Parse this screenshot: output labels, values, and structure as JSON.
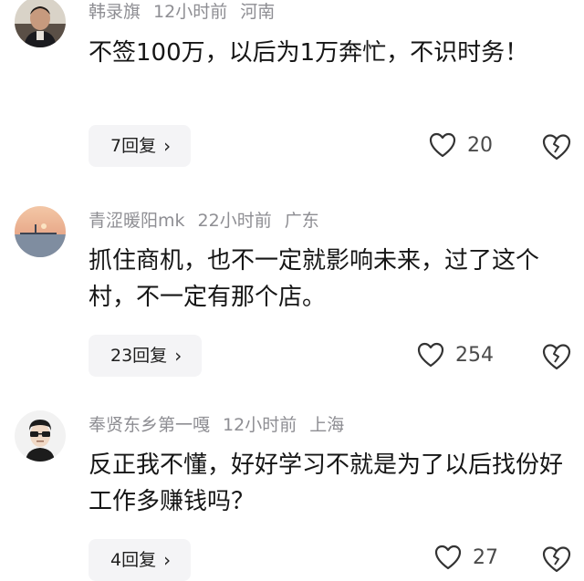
{
  "comments": [
    {
      "username": "韩录旗",
      "time": "12小时前",
      "location": "河南",
      "text": "不签100万，以后为1万奔忙，不识时务！",
      "replies_label": "7回复",
      "likes": "20"
    },
    {
      "username": "青涩暖阳mk",
      "time": "22小时前",
      "location": "广东",
      "text": "抓住商机，也不一定就影响未来，过了这个村，不一定有那个店。",
      "replies_label": "23回复",
      "likes": "254"
    },
    {
      "username": "奉贤东乡第一嘎",
      "time": "12小时前",
      "location": "上海",
      "text": "反正我不懂，好好学习不就是为了以后找份好工作多赚钱吗？",
      "replies_label": "4回复",
      "likes": "27"
    }
  ],
  "icons": {
    "like": "heart-outline-icon",
    "dislike": "broken-heart-icon",
    "chevron": "chevron-right-icon"
  },
  "colors": {
    "meta": "#8e8e93",
    "text": "#161616",
    "reply_bg": "#f4f4f6"
  }
}
